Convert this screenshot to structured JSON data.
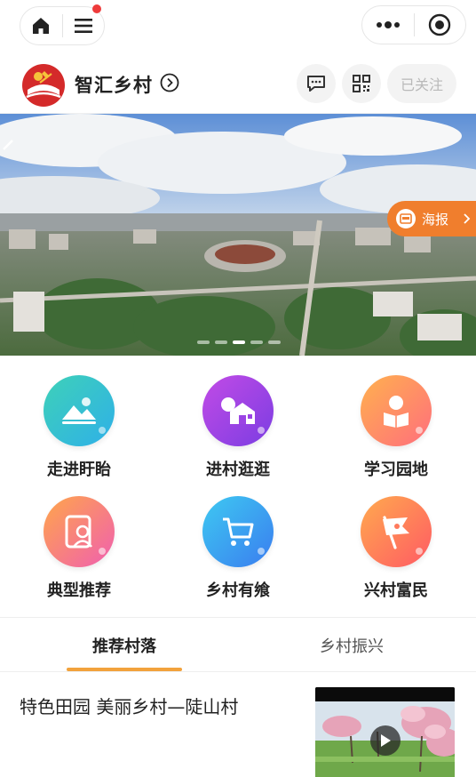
{
  "topbar": {
    "home_icon": "home-icon",
    "menu_icon": "menu-icon",
    "more_icon": "more-dots-icon",
    "close_icon": "target-close-icon",
    "badge_color": "#ee3b3b"
  },
  "header": {
    "brand": "智汇乡村",
    "follow_label": "已关注",
    "message_icon": "message-icon",
    "qrcode_icon": "qrcode-icon"
  },
  "banner": {
    "poster_label": "海报",
    "slide_count": 5,
    "active_slide": 3,
    "accent": "#f07e2d"
  },
  "grid": {
    "items": [
      {
        "label": "走进盱眙",
        "icon": "landscape-icon",
        "colors": [
          "#3ed1b8",
          "#2fb0e8"
        ]
      },
      {
        "label": "进村逛逛",
        "icon": "village-house-icon",
        "colors": [
          "#b23fe0",
          "#7e3fe3"
        ]
      },
      {
        "label": "学习园地",
        "icon": "reading-person-icon",
        "colors": [
          "#ffb14e",
          "#ff6e7d"
        ]
      },
      {
        "label": "典型推荐",
        "icon": "person-card-icon",
        "colors": [
          "#ffa64a",
          "#f05fb0"
        ]
      },
      {
        "label": "乡村有飨",
        "icon": "shopping-cart-icon",
        "colors": [
          "#3ec9f1",
          "#3a7df0"
        ]
      },
      {
        "label": "兴村富民",
        "icon": "flag-icon",
        "colors": [
          "#ffaa4e",
          "#ff5a64"
        ]
      }
    ]
  },
  "tabs": {
    "items": [
      {
        "label": "推荐村落",
        "active": true
      },
      {
        "label": "乡村振兴",
        "active": false
      }
    ],
    "underline_color": "#f2a23c"
  },
  "article": {
    "title": "特色田园 美丽乡村—陡山村",
    "play_icon": "play-icon"
  }
}
